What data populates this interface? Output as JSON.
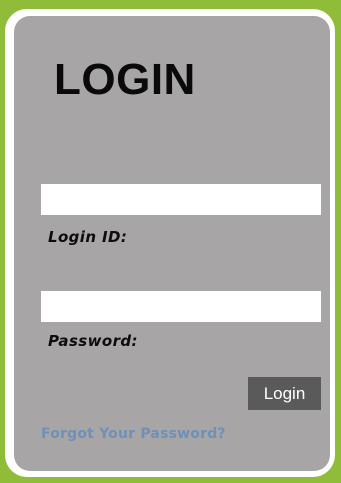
{
  "login_form": {
    "title": "LOGIN",
    "login_id_label": "Login ID:",
    "login_id_value": "",
    "password_label": "Password:",
    "password_value": "",
    "login_button_label": "Login",
    "forgot_password_link": "Forgot Your Password?"
  },
  "colors": {
    "background_green": "#8fbd3a",
    "frame_white": "#ffffff",
    "panel_gray": "#a8a5a6",
    "button_gray": "#5a5a5a",
    "link_blue": "#6f90b8"
  }
}
